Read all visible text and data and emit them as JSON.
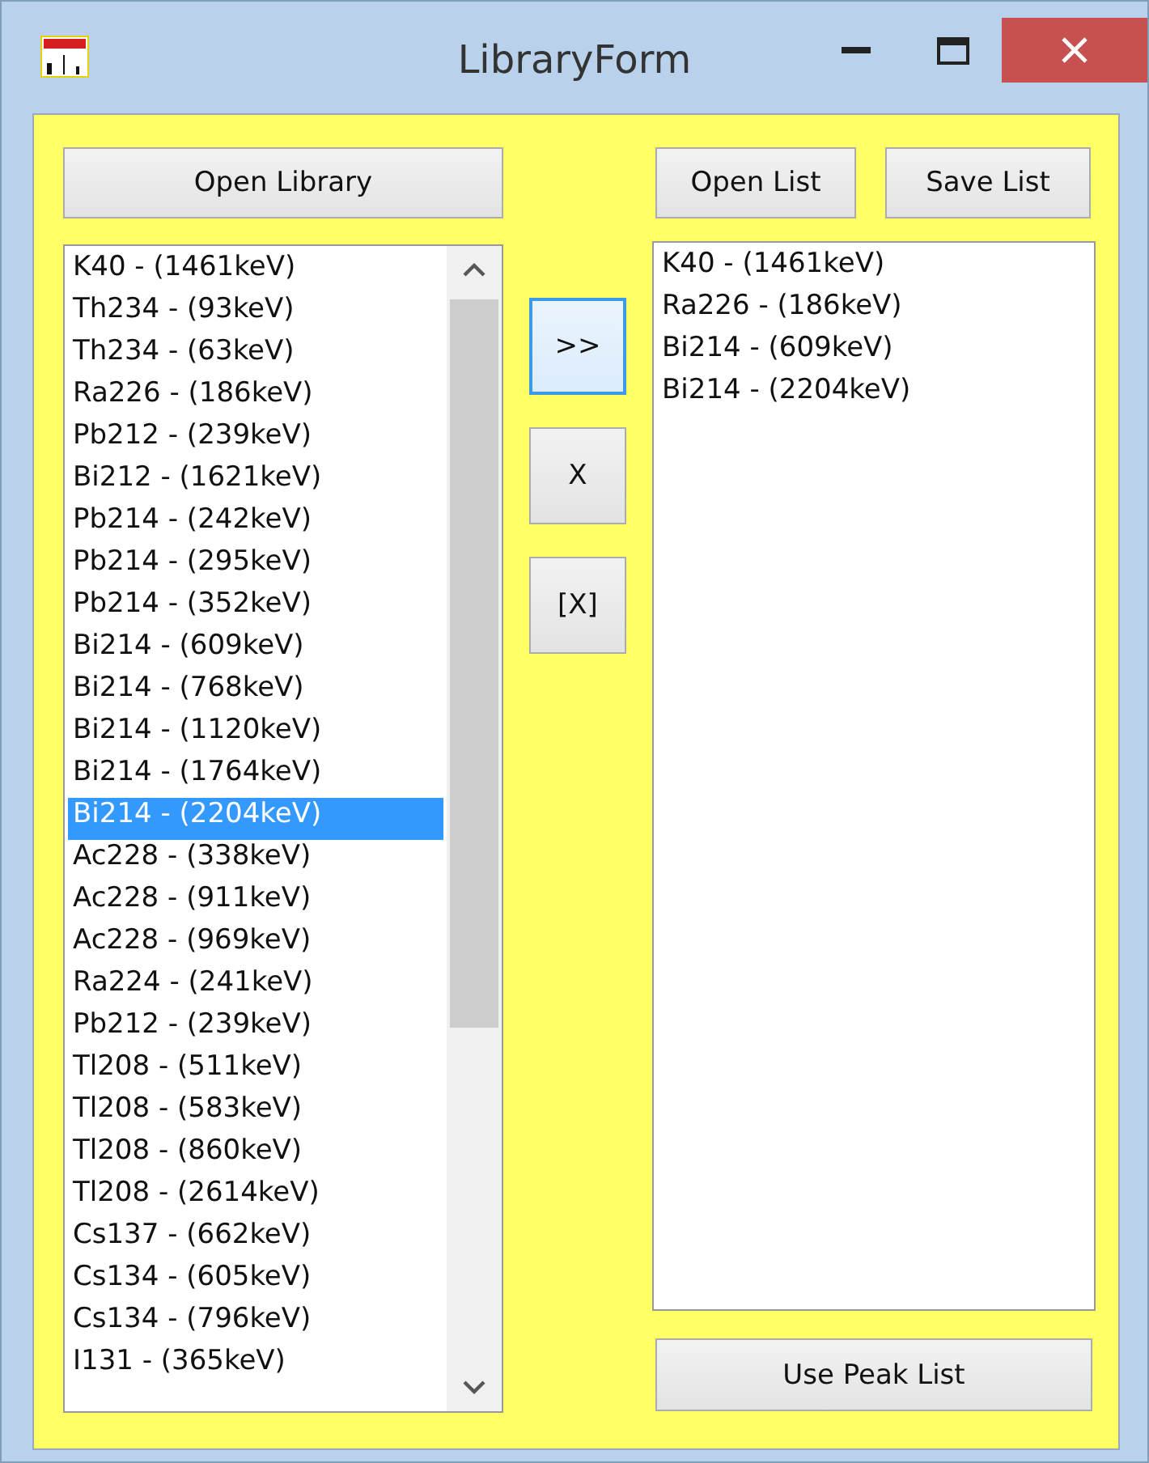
{
  "window": {
    "title": "LibraryForm"
  },
  "library_button": "Open Library",
  "library_list": {
    "items": [
      {
        "label": "K40 - (1461keV)",
        "selected": false
      },
      {
        "label": "Th234 - (93keV)",
        "selected": false
      },
      {
        "label": "Th234 - (63keV)",
        "selected": false
      },
      {
        "label": "Ra226 - (186keV)",
        "selected": false
      },
      {
        "label": "Pb212 - (239keV)",
        "selected": false
      },
      {
        "label": "Bi212 - (1621keV)",
        "selected": false
      },
      {
        "label": "Pb214 - (242keV)",
        "selected": false
      },
      {
        "label": "Pb214 - (295keV)",
        "selected": false
      },
      {
        "label": "Pb214 - (352keV)",
        "selected": false
      },
      {
        "label": "Bi214 - (609keV)",
        "selected": false
      },
      {
        "label": "Bi214 - (768keV)",
        "selected": false
      },
      {
        "label": "Bi214 - (1120keV)",
        "selected": false
      },
      {
        "label": "Bi214 - (1764keV)",
        "selected": false
      },
      {
        "label": "Bi214 - (2204keV)",
        "selected": true
      },
      {
        "label": "Ac228 - (338keV)",
        "selected": false
      },
      {
        "label": "Ac228 - (911keV)",
        "selected": false
      },
      {
        "label": "Ac228 - (969keV)",
        "selected": false
      },
      {
        "label": "Ra224 - (241keV)",
        "selected": false
      },
      {
        "label": "Pb212 - (239keV)",
        "selected": false
      },
      {
        "label": "Tl208 - (511keV)",
        "selected": false
      },
      {
        "label": "Tl208 - (583keV)",
        "selected": false
      },
      {
        "label": "Tl208 - (860keV)",
        "selected": false
      },
      {
        "label": "Tl208 - (2614keV)",
        "selected": false
      },
      {
        "label": "Cs137 - (662keV)",
        "selected": false
      },
      {
        "label": "Cs134 - (605keV)",
        "selected": false
      },
      {
        "label": "Cs134 - (796keV)",
        "selected": false
      },
      {
        "label": "I131 - (365keV)",
        "selected": false
      }
    ]
  },
  "move_buttons": [
    {
      "label": ">>",
      "focused": true
    },
    {
      "label": "X",
      "focused": false
    },
    {
      "label": "[X]",
      "focused": false
    }
  ],
  "list_buttons": [
    "Open List",
    "Save List"
  ],
  "peak_list": {
    "items": [
      {
        "label": "K40 - (1461keV)",
        "selected": false
      },
      {
        "label": "Ra226 - (186keV)",
        "selected": false
      },
      {
        "label": "Bi214 - (609keV)",
        "selected": false
      },
      {
        "label": "Bi214 - (2204keV)",
        "selected": false
      }
    ]
  },
  "use_button": "Use Peak List"
}
